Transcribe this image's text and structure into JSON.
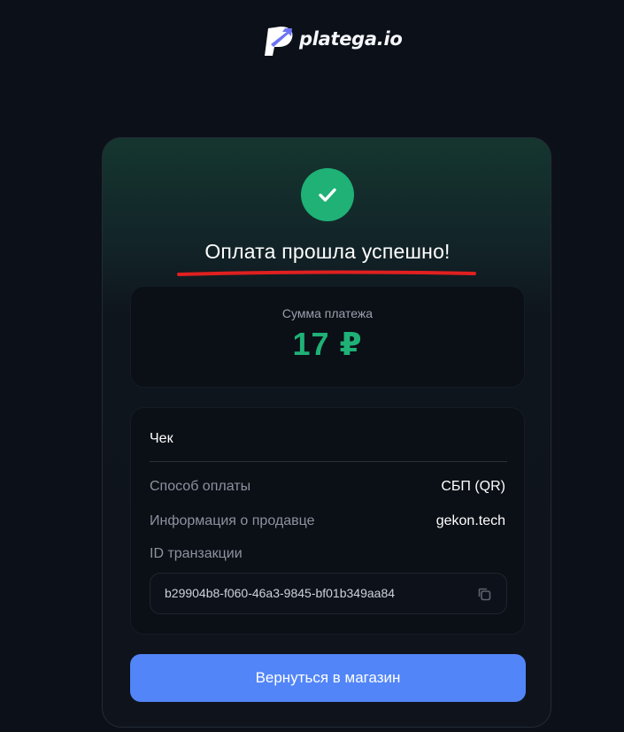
{
  "header": {
    "logo_text": "platega.io"
  },
  "status": {
    "title": "Оплата прошла успешно!"
  },
  "amount": {
    "label": "Сумма платежа",
    "value": "17 ₽"
  },
  "receipt": {
    "title": "Чек",
    "payment_method_label": "Способ оплаты",
    "payment_method_value": "СБП (QR)",
    "seller_label": "Информация о продавце",
    "seller_value": "gekon.tech",
    "transaction_id_label": "ID транзакции",
    "transaction_id_value": "b29904b8-f060-46a3-9845-bf01b349aa84"
  },
  "actions": {
    "back_label": "Вернуться в магазин"
  },
  "colors": {
    "accent_green": "#1fb176",
    "button_blue": "#5285f8",
    "annotation_red": "#e02020",
    "background": "#0c1018"
  },
  "icons": {
    "logo": "platega-logo-icon",
    "success": "checkmark-icon",
    "copy": "copy-icon"
  }
}
